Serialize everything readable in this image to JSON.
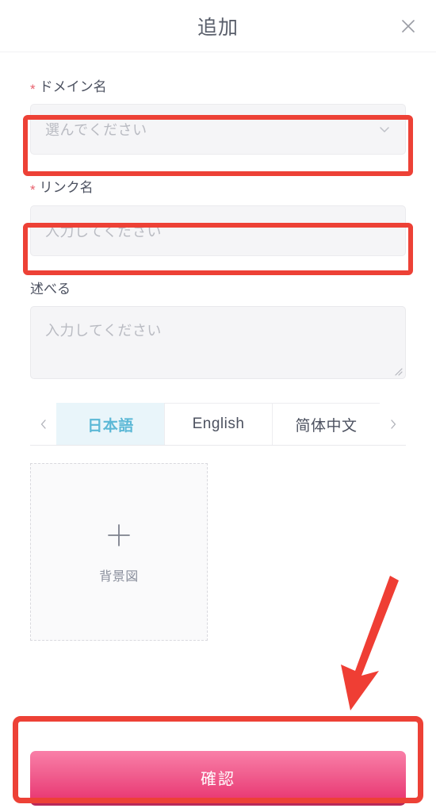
{
  "dialog": {
    "title": "追加",
    "close_icon": "close-icon"
  },
  "form": {
    "fields": [
      {
        "label": "ドメイン名",
        "required": true,
        "required_marker": "*",
        "type": "select",
        "value": "",
        "placeholder": "選んでください",
        "icon": "chevron-down-icon",
        "highlighted": true
      },
      {
        "label": "リンク名",
        "required": true,
        "required_marker": "*",
        "type": "text",
        "value": "",
        "placeholder": "入力してください",
        "highlighted": true
      },
      {
        "label": "述べる",
        "required": false,
        "required_marker": "",
        "type": "textarea",
        "value": "",
        "placeholder": "入力してください",
        "highlighted": false
      }
    ]
  },
  "language_tabs": {
    "prev_icon": "chevron-left-icon",
    "next_icon": "chevron-right-icon",
    "active_index": 0,
    "items": [
      {
        "label": "日本語"
      },
      {
        "label": "English"
      },
      {
        "label": "简体中文"
      }
    ]
  },
  "upload": {
    "plus_icon": "plus-icon",
    "label": "背景図"
  },
  "footer": {
    "confirm_label": "確認"
  },
  "annotations": {
    "box_color": "#ed4136",
    "arrow_color": "#ef3e34",
    "arrow_icon": "arrow-down-left-icon"
  },
  "colors": {
    "accent_tab": "#5cb8d6",
    "accent_tab_bg": "#e9f5fa",
    "confirm_gradient_top": "#f97fa8",
    "confirm_gradient_bottom": "#e8336f",
    "required_star": "#e8616d",
    "field_bg": "#f5f5f7",
    "placeholder": "#b9bbc2",
    "title": "#5a5f6b"
  }
}
